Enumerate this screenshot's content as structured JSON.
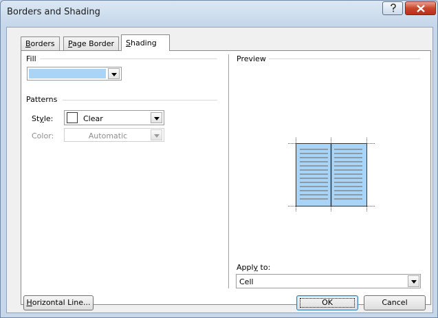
{
  "window": {
    "title": "Borders and Shading"
  },
  "tabs": [
    {
      "label": "Borders",
      "mnemonic": "B",
      "rest": "orders"
    },
    {
      "label": "Page Border",
      "mnemonic": "P",
      "rest": "age Border"
    },
    {
      "label": "Shading",
      "mnemonic": "S",
      "rest": "hading"
    }
  ],
  "fill": {
    "label": "Fill",
    "color": "#a8d4f7"
  },
  "patterns": {
    "label": "Patterns",
    "style_label_pre": "St",
    "style_mnemonic": "y",
    "style_label_post": "le:",
    "style_value": "Clear",
    "color_label": "Color:",
    "color_value": "Automatic"
  },
  "preview": {
    "label": "Preview",
    "shading_color": "#a8d4f7"
  },
  "apply_to": {
    "label_pre": "Appl",
    "label_mnemonic": "y",
    "label_post": " to:",
    "value": "Cell"
  },
  "buttons": {
    "horizontal_line_mnemonic": "H",
    "horizontal_line_rest": "orizontal Line...",
    "ok": "OK",
    "cancel": "Cancel"
  }
}
